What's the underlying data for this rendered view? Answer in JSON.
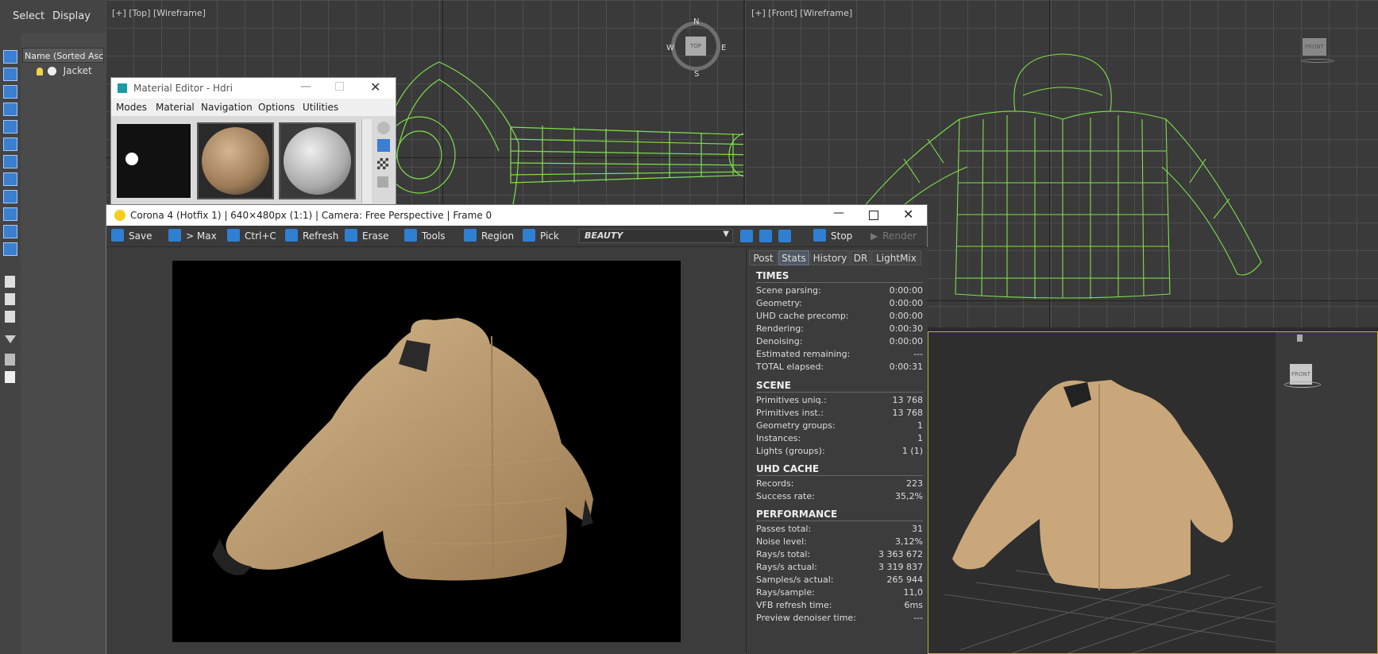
{
  "main_menu": {
    "select": "Select",
    "display": "Display"
  },
  "scene_explorer": {
    "column_header": "Name (Sorted Ascending)",
    "items": [
      {
        "label": "Jacket"
      }
    ]
  },
  "viewports": {
    "top": {
      "label": "[+] [Top] [Wireframe]",
      "viewcube": {
        "n": "N",
        "s": "S",
        "e": "E",
        "w": "W",
        "face": "TOP"
      }
    },
    "front": {
      "label": "[+] [Front] [Wireframe]",
      "viewcube_face": "FRONT"
    },
    "perspective": {
      "viewcube_face": "FRONT"
    }
  },
  "material_editor": {
    "title": "Material Editor - Hdri",
    "menu": [
      "Modes",
      "Material",
      "Navigation",
      "Options",
      "Utilities"
    ]
  },
  "corona_vfb": {
    "title": "Corona 4 (Hotfix 1) | 640×480px (1:1) | Camera: Free Perspective | Frame 0",
    "toolbar": {
      "save": "Save",
      "to_max": "> Max",
      "copy": "Ctrl+C",
      "refresh": "Refresh",
      "erase": "Erase",
      "tools": "Tools",
      "region": "Region",
      "pick": "Pick",
      "channel": "BEAUTY",
      "stop": "Stop",
      "render": "Render"
    },
    "tabs": [
      "Post",
      "Stats",
      "History",
      "DR",
      "LightMix"
    ],
    "active_tab": "Stats",
    "stats": {
      "times": {
        "title": "TIMES",
        "rows": [
          {
            "k": "Scene parsing:",
            "v": "0:00:00"
          },
          {
            "k": "Geometry:",
            "v": "0:00:00"
          },
          {
            "k": "UHD cache precomp:",
            "v": "0:00:00"
          },
          {
            "k": "Rendering:",
            "v": "0:00:30"
          },
          {
            "k": "Denoising:",
            "v": "0:00:00"
          },
          {
            "k": "Estimated remaining:",
            "v": "---"
          },
          {
            "k": "TOTAL elapsed:",
            "v": "0:00:31"
          }
        ]
      },
      "scene": {
        "title": "SCENE",
        "rows": [
          {
            "k": "Primitives uniq.:",
            "v": "13 768"
          },
          {
            "k": "Primitives inst.:",
            "v": "13 768"
          },
          {
            "k": "Geometry groups:",
            "v": "1"
          },
          {
            "k": "Instances:",
            "v": "1"
          },
          {
            "k": "Lights (groups):",
            "v": "1 (1)"
          }
        ]
      },
      "uhd": {
        "title": "UHD CACHE",
        "rows": [
          {
            "k": "Records:",
            "v": "223"
          },
          {
            "k": "Success rate:",
            "v": "35,2%"
          }
        ]
      },
      "perf": {
        "title": "PERFORMANCE",
        "rows": [
          {
            "k": "Passes total:",
            "v": "31"
          },
          {
            "k": "Noise level:",
            "v": "3,12%"
          },
          {
            "k": "Rays/s total:",
            "v": "3 363 672"
          },
          {
            "k": "Rays/s actual:",
            "v": "3 319 837"
          },
          {
            "k": "Samples/s actual:",
            "v": "265 944"
          },
          {
            "k": "Rays/sample:",
            "v": "11,0"
          },
          {
            "k": "VFB refresh time:",
            "v": "6ms"
          },
          {
            "k": "Preview denoiser time:",
            "v": "---"
          }
        ]
      }
    }
  },
  "colors": {
    "accent": "#2f7fd2",
    "wire": "#7ee04a",
    "jacket": "#c9a77a",
    "selection": "#c8a93c"
  }
}
